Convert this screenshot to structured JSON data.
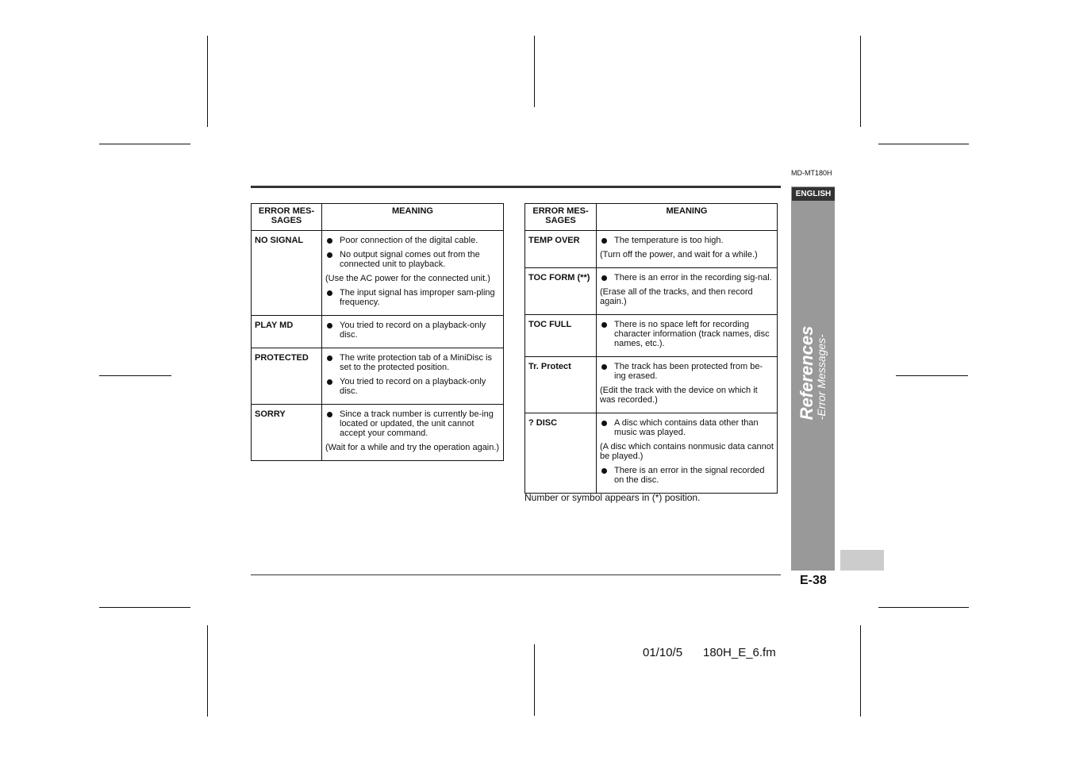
{
  "header": {
    "model": "MD-MT180H",
    "language_tab": "ENGLISH"
  },
  "sidebar": {
    "section_title": "References",
    "section_subtitle": "-Error Messages-"
  },
  "tables": [
    {
      "headers": [
        "ERROR MES-\nSAGES",
        "MEANING"
      ],
      "rows": [
        {
          "message": "NO SIGNAL",
          "items": [
            {
              "type": "bullet",
              "text": "Poor connection of the digital cable."
            },
            {
              "type": "bullet",
              "text": "No output signal comes out from the connected unit to playback."
            },
            {
              "type": "note",
              "text": "(Use the AC power for the connected unit.)"
            },
            {
              "type": "bullet",
              "text": "The input signal has improper sam-pling frequency."
            }
          ]
        },
        {
          "message": "PLAY MD",
          "items": [
            {
              "type": "bullet",
              "text": "You tried to record on a playback-only disc."
            }
          ]
        },
        {
          "message": "PROTECTED",
          "items": [
            {
              "type": "bullet",
              "text": "The write protection tab of a MiniDisc is set to the protected position."
            },
            {
              "type": "bullet",
              "text": "You tried to record on a playback-only disc."
            }
          ]
        },
        {
          "message": "SORRY",
          "items": [
            {
              "type": "bullet",
              "text": "Since a track number is currently be-ing located or updated, the unit cannot accept your command."
            },
            {
              "type": "note",
              "text": "(Wait for a while and try the operation again.)"
            }
          ]
        }
      ]
    },
    {
      "headers": [
        "ERROR MES-\nSAGES",
        "MEANING"
      ],
      "rows": [
        {
          "message": "TEMP OVER",
          "items": [
            {
              "type": "bullet",
              "text": "The temperature is too high."
            },
            {
              "type": "note",
              "text": "(Turn off the power, and wait for a while.)"
            }
          ]
        },
        {
          "message": "TOC FORM (**)",
          "items": [
            {
              "type": "bullet",
              "text": "There is an error in the recording sig-nal."
            },
            {
              "type": "note",
              "text": "(Erase all of the tracks, and then record again.)"
            }
          ]
        },
        {
          "message": "TOC FULL",
          "items": [
            {
              "type": "bullet",
              "text": "There is no space left for recording character information (track names, disc names, etc.)."
            }
          ]
        },
        {
          "message": "Tr. Protect",
          "items": [
            {
              "type": "bullet",
              "text": "The track has been protected from be-ing erased."
            },
            {
              "type": "note",
              "text": "(Edit the track with the device on which it was recorded.)"
            }
          ]
        },
        {
          "message": "? DISC",
          "items": [
            {
              "type": "bullet",
              "text": "A disc which contains data other than music was played."
            },
            {
              "type": "note",
              "text": "(A disc which contains nonmusic data cannot be played.)"
            },
            {
              "type": "bullet",
              "text": "There is an error in the signal recorded on the disc."
            }
          ]
        }
      ]
    }
  ],
  "footnote": "Number or symbol appears in (*) position.",
  "page_number": "E-38",
  "footer": {
    "date": "01/10/5",
    "filename": "180H_E_6.fm"
  }
}
